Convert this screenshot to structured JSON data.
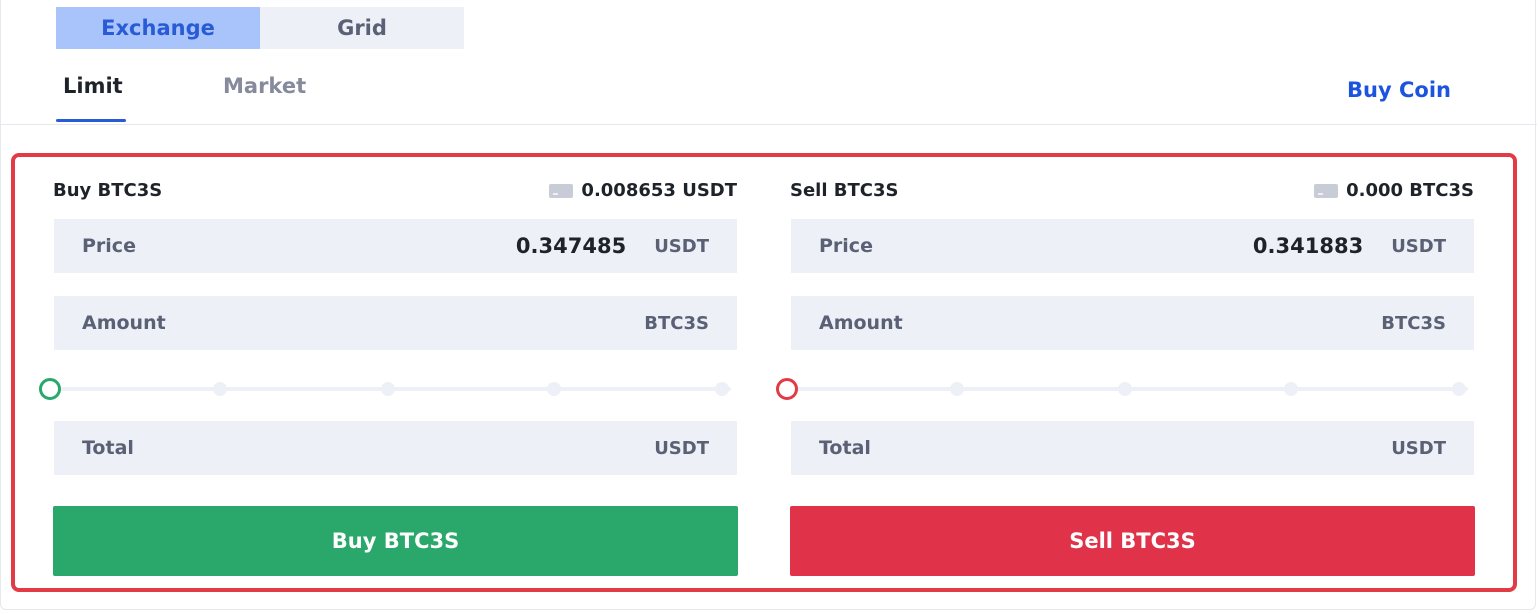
{
  "mode_toggle": {
    "options": [
      "Exchange",
      "Grid"
    ],
    "active": "Exchange"
  },
  "tabs": {
    "limit": "Limit",
    "market": "Market",
    "active": "Limit"
  },
  "buy_coin": "Buy Coin",
  "colors": {
    "accent": "#2a5bd7",
    "buy": "#2aa86b",
    "sell": "#e0334a",
    "highlight": "#e23b45",
    "field_bg": "#eef0f8"
  },
  "buy_form": {
    "title": "Buy BTC3S",
    "balance": "0.008653 USDT",
    "price": {
      "label": "Price",
      "value": "0.347485",
      "unit": "USDT"
    },
    "amount": {
      "label": "Amount",
      "value": "",
      "unit": "BTC3S"
    },
    "slider_percent": 0,
    "total": {
      "label": "Total",
      "value": "",
      "unit": "USDT"
    },
    "button": "Buy BTC3S"
  },
  "sell_form": {
    "title": "Sell BTC3S",
    "balance": "0.000 BTC3S",
    "price": {
      "label": "Price",
      "value": "0.341883",
      "unit": "USDT"
    },
    "amount": {
      "label": "Amount",
      "value": "",
      "unit": "BTC3S"
    },
    "slider_percent": 0,
    "total": {
      "label": "Total",
      "value": "",
      "unit": "USDT"
    },
    "button": "Sell BTC3S"
  }
}
